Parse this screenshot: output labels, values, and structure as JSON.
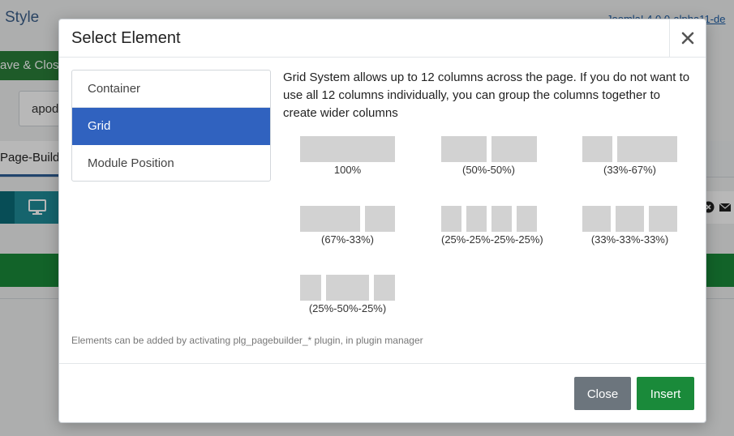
{
  "background": {
    "title": "Style",
    "version_link": "Joomla! 4.0.0-alpha11-de",
    "save_button": "ave & Clos",
    "input_value": "apod",
    "tab_label": "Page-Builde"
  },
  "modal": {
    "title": "Select Element",
    "close_symbol": "×",
    "sidebar": [
      {
        "label": "Container",
        "active": false
      },
      {
        "label": "Grid",
        "active": true
      },
      {
        "label": "Module Position",
        "active": false
      }
    ],
    "description": "Grid System allows up to 12 columns across the page. If you do not want to use all 12 columns individually, you can group the columns together to create wider columns",
    "grid_options": [
      {
        "label": "100%",
        "columns": [
          100
        ]
      },
      {
        "label": "(50%-50%)",
        "columns": [
          50,
          50
        ]
      },
      {
        "label": "(33%-67%)",
        "columns": [
          33,
          67
        ]
      },
      {
        "label": "(67%-33%)",
        "columns": [
          67,
          33
        ]
      },
      {
        "label": "(25%-25%-25%-25%)",
        "columns": [
          25,
          25,
          25,
          25
        ]
      },
      {
        "label": "(33%-33%-33%)",
        "columns": [
          33,
          33,
          33
        ]
      },
      {
        "label": "(25%-50%-25%)",
        "columns": [
          25,
          50,
          25
        ]
      }
    ],
    "hint": "Elements can be added by activating plg_pagebuilder_* plugin, in plugin manager",
    "footer": {
      "close_label": "Close",
      "insert_label": "Insert"
    }
  },
  "colors": {
    "active_item": "#3062bf",
    "insert_button": "#1a8a3a",
    "close_button": "#6c757d",
    "grid_block": "#d2d2d2"
  }
}
